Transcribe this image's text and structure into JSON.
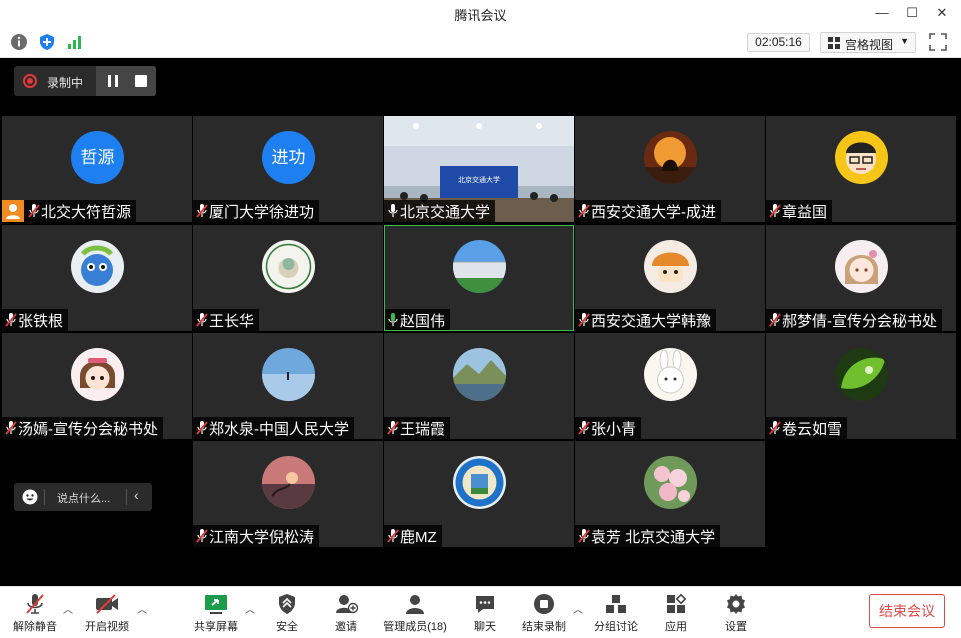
{
  "window": {
    "title": "腾讯会议",
    "minimize": "—",
    "maximize": "☐",
    "close": "✕"
  },
  "toolbar": {
    "timer": "02:05:16",
    "view_label": "宫格视图",
    "view_caret": "▼"
  },
  "recording": {
    "label": "录制中"
  },
  "tiles": [
    {
      "name": "北交大符哲源",
      "avatar_text": "哲源",
      "mic": "muted",
      "host": true
    },
    {
      "name": "厦门大学徐进功",
      "avatar_text": "进功",
      "mic": "muted"
    },
    {
      "name": "北京交通大学",
      "avatar": "video-conference-room",
      "mic": "on"
    },
    {
      "name": "西安交通大学-成进",
      "avatar": "rooster-sunset-photo",
      "mic": "muted"
    },
    {
      "name": "章益国",
      "avatar": "cartoon-man-glasses",
      "mic": "muted"
    },
    {
      "name": "张铁根",
      "avatar": "cartoon-blue-creature",
      "mic": "muted"
    },
    {
      "name": "王长华",
      "avatar": "university-seal-logo",
      "mic": "muted"
    },
    {
      "name": "赵国伟",
      "avatar": "building-sky-photo",
      "mic": "on",
      "active": true
    },
    {
      "name": "西安交通大学韩豫",
      "avatar": "mushroom-character",
      "mic": "muted"
    },
    {
      "name": "郝梦倩-宣传分会秘书处",
      "avatar": "anime-girl",
      "mic": "muted"
    },
    {
      "name": "汤嫣-宣传分会秘书处",
      "avatar": "cartoon-girl",
      "mic": "muted"
    },
    {
      "name": "郑水泉-中国人民大学",
      "avatar": "blue-lake-photo",
      "mic": "muted"
    },
    {
      "name": "王瑞霞",
      "avatar": "mountain-lake-photo",
      "mic": "muted"
    },
    {
      "name": "张小青",
      "avatar": "cute-rabbit",
      "mic": "muted"
    },
    {
      "name": "卷云如雪",
      "avatar": "green-leaf-drop",
      "mic": "muted"
    },
    {
      "name": "江南大学倪松涛",
      "avatar": "sunset-hand-photo",
      "mic": "muted"
    },
    {
      "name": "鹿MZ",
      "avatar": "university-badge-logo",
      "mic": "muted"
    },
    {
      "name": "袁芳 北京交通大学",
      "avatar": "flowers-photo",
      "mic": "muted"
    }
  ],
  "chat": {
    "placeholder": "说点什么..."
  },
  "bottom": {
    "unmute": "解除静音",
    "start_video": "开启视频",
    "share_screen": "共享屏幕",
    "security": "安全",
    "invite": "邀请",
    "manage_members": "管理成员(18)",
    "chat": "聊天",
    "end_recording": "结束录制",
    "breakout": "分组讨论",
    "apps": "应用",
    "settings": "设置",
    "end_meeting": "结束会议"
  },
  "colors": {
    "accent_blue": "#1e80f0",
    "record_red": "#e23a3a",
    "end_red": "#e04a4a",
    "active_green": "#3fb950",
    "host_orange": "#f08c22"
  }
}
